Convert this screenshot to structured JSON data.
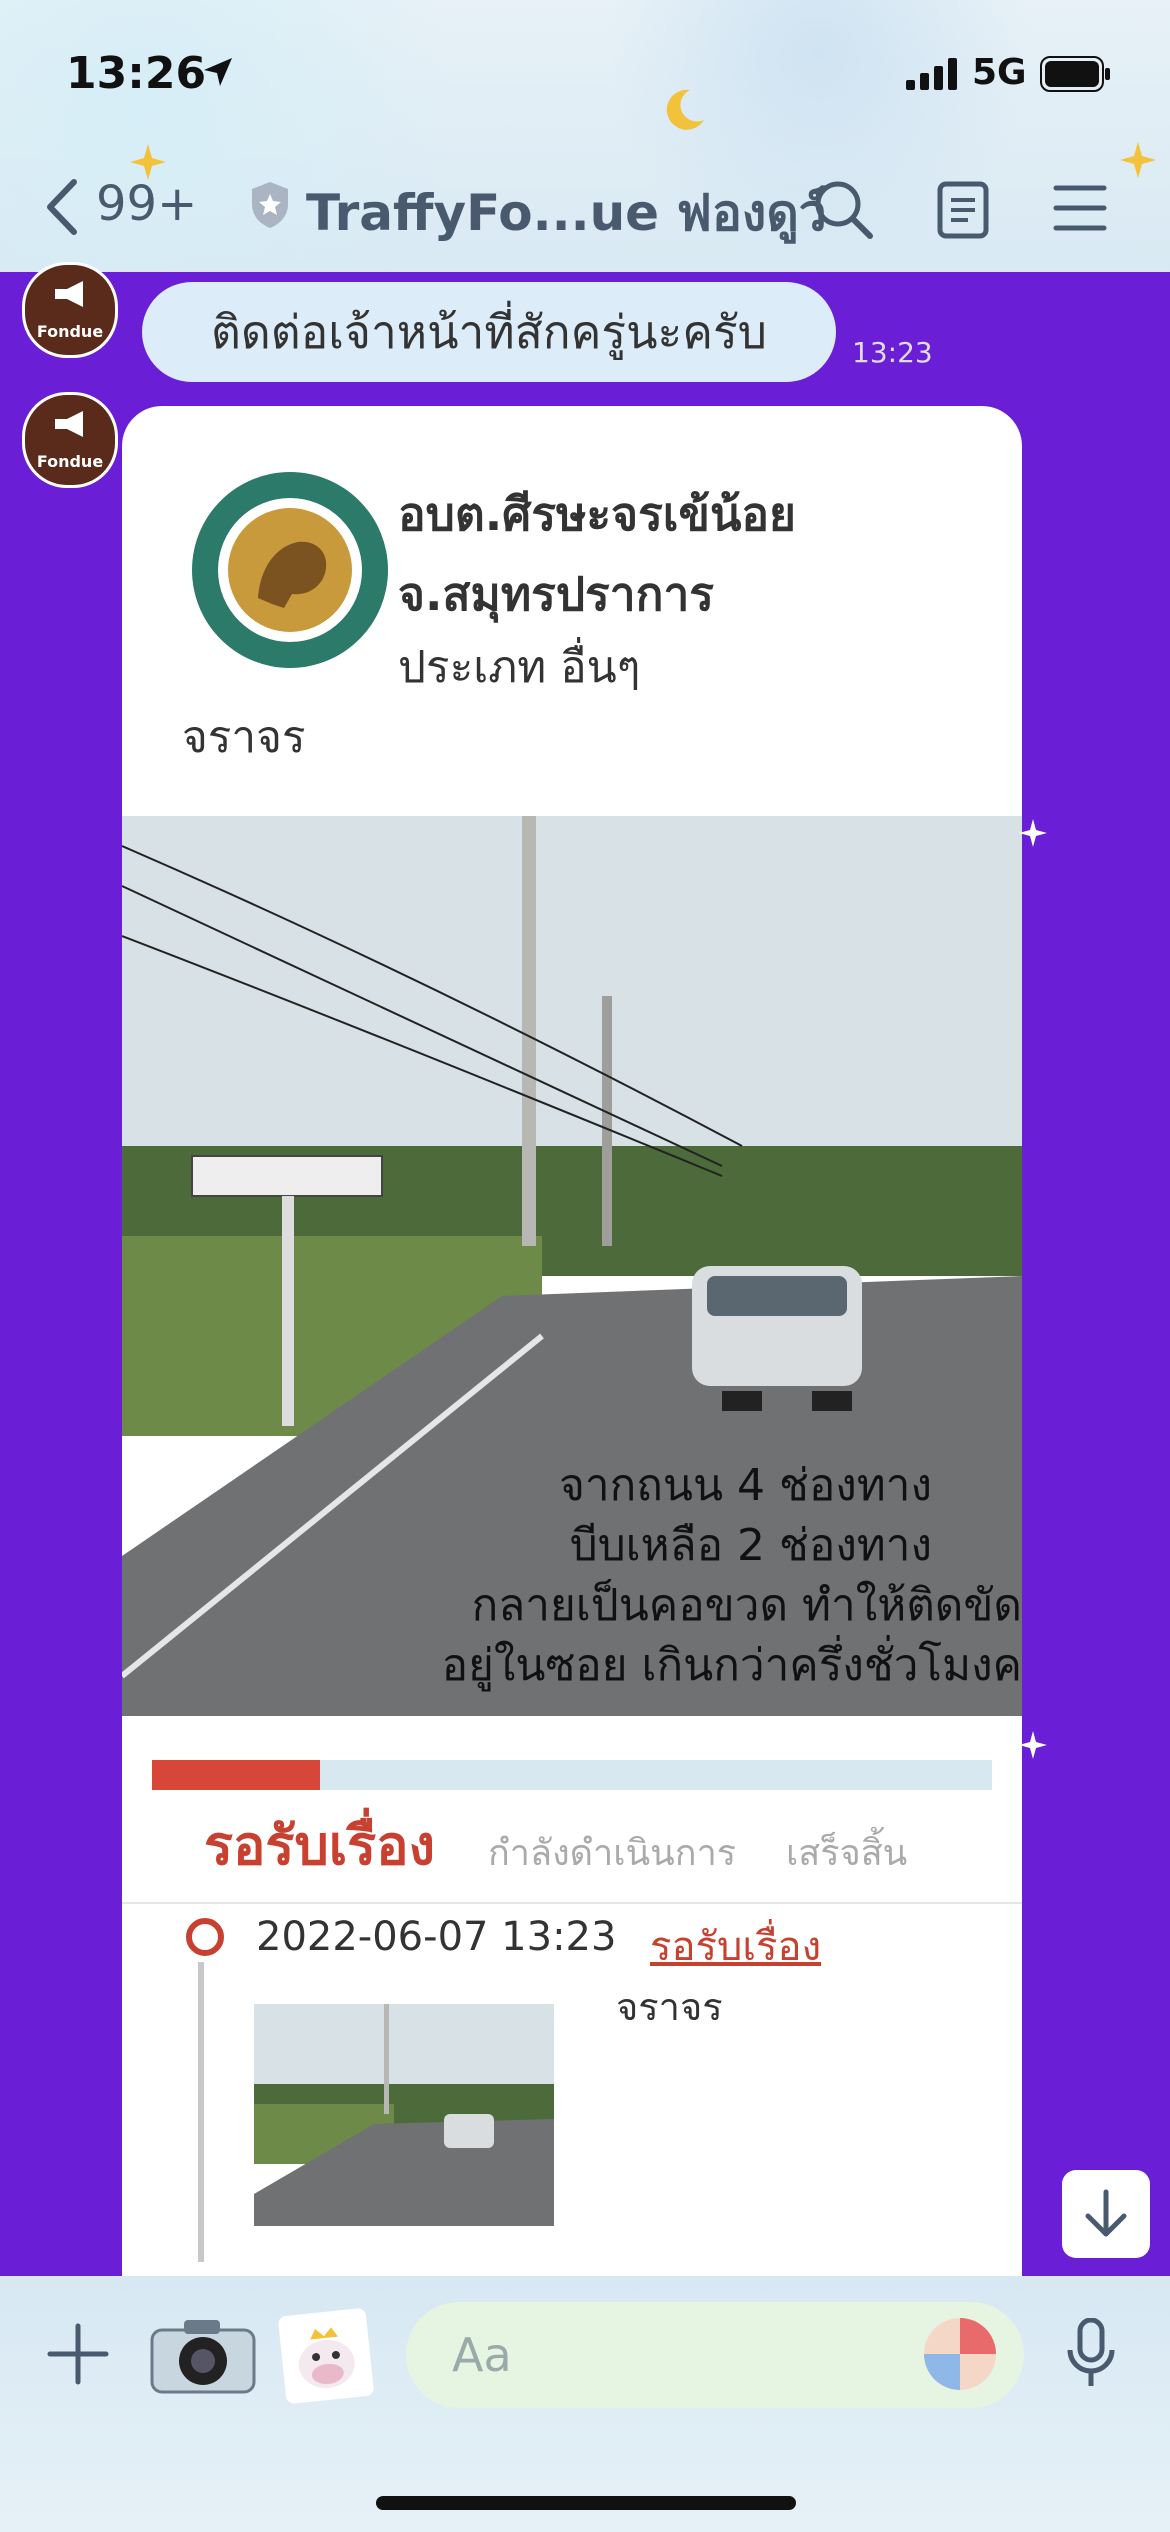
{
  "status_bar": {
    "time": "13:26",
    "network": "5G"
  },
  "nav": {
    "back_count": "99+",
    "title": "TraffyFo...ue ฟองดูว์"
  },
  "avatar": {
    "label": "Fondue"
  },
  "messages": [
    {
      "text": "ติดต่อเจ้าหน้าที่สักครู่นะครับ",
      "time": "13:23"
    }
  ],
  "card": {
    "org_line1": "อบต.ศีรษะจรเข้น้อย",
    "org_line2": "จ.สมุทรปราการ",
    "type": "ประเภท อื่นๆ",
    "category": "จราจร",
    "photo_caption": [
      "จากถนน 4 ช่องทาง",
      "บีบเหลือ 2 ช่องทาง",
      "กลายเป็นคอขวด ทำให้ติดขัด",
      "อยู่ในซอย เกินกว่าครึ่งชั่วโมงค"
    ],
    "progress_fraction": 0.2,
    "statuses": {
      "active": "รอรับเรื่อง",
      "in_progress": "กำลังดำเนินการ",
      "done": "เสร็จสิ้น"
    },
    "timeline": [
      {
        "date": "2022-06-07 13:23",
        "status": "รอรับเรื่อง",
        "category": "จราจร"
      }
    ]
  },
  "input": {
    "placeholder": "Aa"
  },
  "colors": {
    "chat_bg": "#6a1fd6",
    "accent": "#c8402f",
    "bubble": "#dcecf8"
  }
}
